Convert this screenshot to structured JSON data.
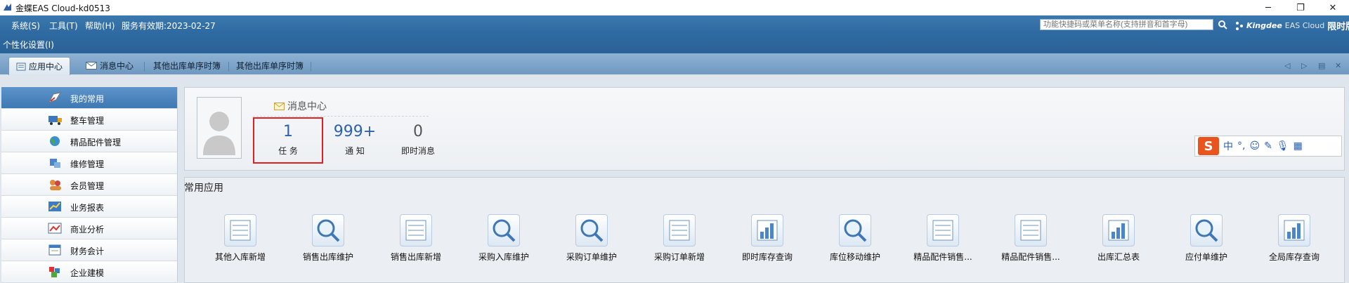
{
  "window": {
    "title": "金蝶EAS Cloud-kd0513"
  },
  "menubar": {
    "items": [
      "系统(S)",
      "工具(T)",
      "帮助(H)",
      "服务有效期:2023-02-27"
    ],
    "search_placeholder": "功能快捷码或菜单名称(支持拼音和首字母)",
    "brand": {
      "logo": "Kingdee",
      "product": "EAS Cloud",
      "edition": "限时版"
    }
  },
  "personalize": {
    "label": "个性化设置(I)"
  },
  "tabs": [
    "应用中心",
    "消息中心",
    "其他出库单序时簿",
    "其他出库单序时簿"
  ],
  "sidebar": {
    "items": [
      {
        "label": "我的常用",
        "icon": "favorites-icon",
        "active": true
      },
      {
        "label": "整车管理",
        "icon": "truck-icon"
      },
      {
        "label": "精品配件管理",
        "icon": "globe-icon"
      },
      {
        "label": "维修管理",
        "icon": "repair-icon"
      },
      {
        "label": "会员管理",
        "icon": "members-icon"
      },
      {
        "label": "业务报表",
        "icon": "report-icon"
      },
      {
        "label": "商业分析",
        "icon": "analysis-icon"
      },
      {
        "label": "财务会计",
        "icon": "accounting-icon"
      },
      {
        "label": "企业建模",
        "icon": "modeling-icon"
      }
    ]
  },
  "message_center": {
    "title": "消息中心",
    "stats": [
      {
        "value": "1",
        "label": "任 务"
      },
      {
        "value": "999+",
        "label": "通 知"
      },
      {
        "value": "0",
        "label": "即时消息"
      }
    ]
  },
  "ime_toolbar": {
    "logo": "S",
    "mode": "中",
    "punct": "°,"
  },
  "common_apps": {
    "title": "常用应用",
    "items": [
      {
        "label": "其他入库新增",
        "icon": "form-icon"
      },
      {
        "label": "销售出库维护",
        "icon": "magnifier-icon"
      },
      {
        "label": "销售出库新增",
        "icon": "form-icon"
      },
      {
        "label": "采购入库维护",
        "icon": "magnifier-icon"
      },
      {
        "label": "采购订单维护",
        "icon": "magnifier-icon"
      },
      {
        "label": "采购订单新增",
        "icon": "form-icon"
      },
      {
        "label": "即时库存查询",
        "icon": "bar-chart-icon"
      },
      {
        "label": "库位移动维护",
        "icon": "magnifier-icon"
      },
      {
        "label": "精品配件销售...",
        "icon": "form-icon"
      },
      {
        "label": "精品配件销售...",
        "icon": "form-icon"
      },
      {
        "label": "出库汇总表",
        "icon": "bar-chart-icon"
      },
      {
        "label": "应付单维护",
        "icon": "magnifier-icon"
      },
      {
        "label": "全局库存查询",
        "icon": "bar-chart-icon"
      }
    ]
  },
  "colors": {
    "accent": "#2f62a8",
    "highlight": "#e02020",
    "menubar": "#3b78ad"
  }
}
